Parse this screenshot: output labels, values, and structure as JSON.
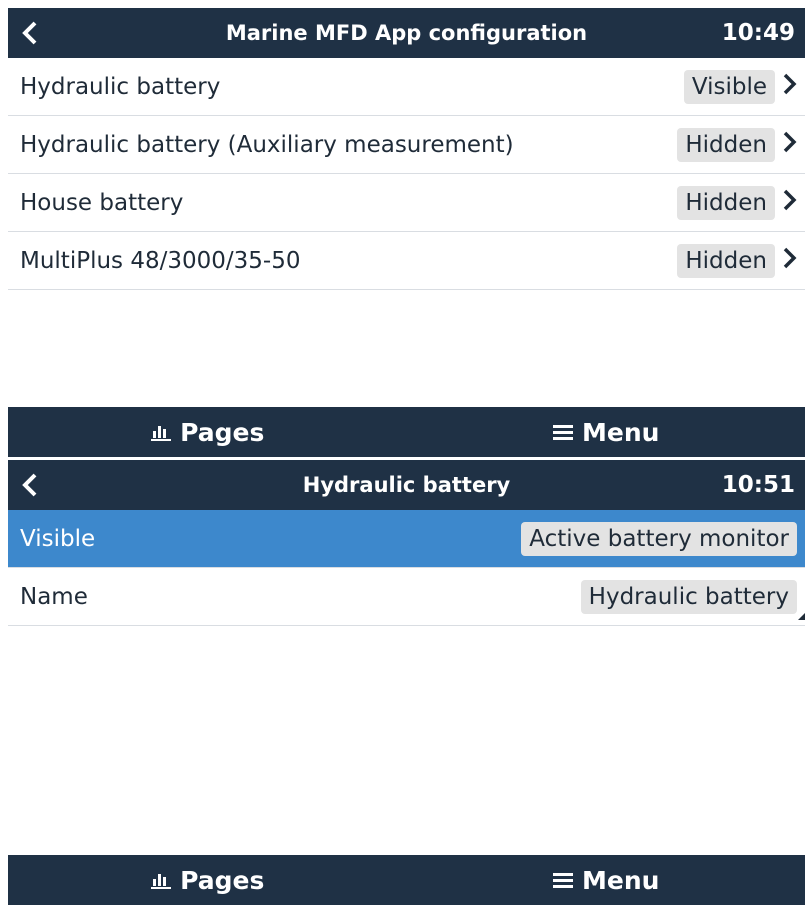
{
  "screen1": {
    "title": "Marine MFD App configuration",
    "time": "10:49",
    "items": [
      {
        "label": "Hydraulic battery",
        "value": "Visible"
      },
      {
        "label": "Hydraulic battery (Auxiliary measurement)",
        "value": "Hidden"
      },
      {
        "label": "House battery",
        "value": "Hidden"
      },
      {
        "label": "MultiPlus 48/3000/35-50",
        "value": "Hidden"
      }
    ]
  },
  "screen2": {
    "title": "Hydraulic battery",
    "time": "10:51",
    "items": [
      {
        "label": "Visible",
        "value": "Active battery monitor"
      },
      {
        "label": "Name",
        "value": "Hydraulic battery"
      }
    ]
  },
  "bottombar": {
    "pages_label": "Pages",
    "menu_label": "Menu"
  },
  "icons": {
    "back": "chevron-left-icon",
    "row": "chevron-right-icon",
    "pages": "bar-chart-icon",
    "menu": "hamburger-icon"
  },
  "colors": {
    "header": "#1f3145",
    "selected_row": "#3d88cc",
    "badge": "#e3e3e3"
  }
}
